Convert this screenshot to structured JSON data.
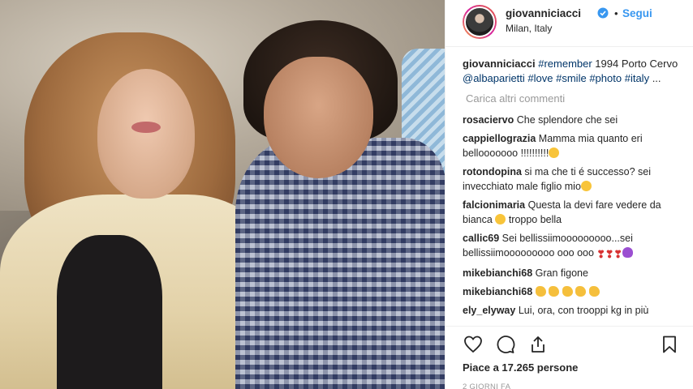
{
  "post": {
    "username": "giovanniciacci",
    "location": "Milan, Italy",
    "follow_label": "Segui",
    "dot": "•"
  },
  "caption": {
    "username": "giovanniciacci",
    "parts": [
      "#remember",
      " 1994 Porto Cervo ",
      "@albaparietti",
      " ",
      "#love",
      " ",
      "#smile",
      " ",
      "#photo",
      " ",
      "#italy",
      " ..."
    ]
  },
  "load_more": "Carica altri commenti",
  "comments": [
    {
      "user": "rosaciervo",
      "text": "Che splendore che sei",
      "emoji": []
    },
    {
      "user": "cappiellograzia",
      "text": "Mamma mia quanto eri bellooooooo !!!!!!!!!!",
      "emoji": [
        "face"
      ]
    },
    {
      "user": "rotondopina",
      "text": "si ma che ti é successo? sei invecchiato male figlio mio",
      "emoji": [
        "face"
      ]
    },
    {
      "user": "falcionimaria",
      "text": "Questa la devi fare vedere da bianca",
      "text2": "troppo bella",
      "emoji": [
        "face"
      ]
    },
    {
      "user": "callic69",
      "text": "Sei bellissiimooooooooo...sei bellissiimooooooooo ooo ooo",
      "emoji": [
        "heart-exclamation",
        "heart-exclamation",
        "heart-exclamation",
        "purple-heart"
      ]
    },
    {
      "user": "mikebianchi68",
      "text": "Gran figone",
      "emoji": []
    },
    {
      "user": "mikebianchi68",
      "text": "",
      "emoji": [
        "clap",
        "clap",
        "clap",
        "clap",
        "clap"
      ]
    },
    {
      "user": "ely_elyway",
      "text": "Lui, ora, con trooppi kg in più",
      "emoji": []
    }
  ],
  "likes": "Piace a 17.265 persone",
  "time": "2 GIORNI FA",
  "icons": [
    "heart-icon",
    "comment-icon",
    "share-icon",
    "bookmark-icon",
    "verified-icon"
  ],
  "colors": {
    "link": "#003569",
    "follow": "#3897f0",
    "muted": "#999999"
  }
}
